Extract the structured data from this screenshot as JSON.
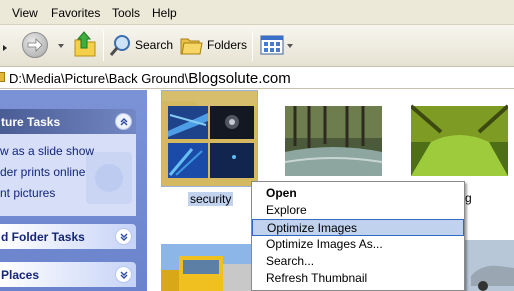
{
  "menubar": {
    "items": [
      {
        "label": "View"
      },
      {
        "label": "Favorites"
      },
      {
        "label": "Tools"
      },
      {
        "label": "Help"
      }
    ]
  },
  "toolbar": {
    "search_label": "Search",
    "folders_label": "Folders"
  },
  "address": {
    "path": "D:\\Media\\Picture\\Back Ground\\",
    "site": "Blogsolute.com"
  },
  "taskpane": {
    "picture_tasks": {
      "title": "ture Tasks",
      "items": [
        {
          "label": "w as a slide show"
        },
        {
          "label": "der prints online"
        },
        {
          "label": "nt pictures"
        }
      ]
    },
    "file_folder_tasks": {
      "title": "d Folder Tasks"
    },
    "other_places": {
      "title": "Places"
    }
  },
  "files": [
    {
      "label": "security"
    },
    {
      "label": "g"
    }
  ],
  "context_menu": {
    "items": [
      {
        "label": "Open"
      },
      {
        "label": "Explore"
      },
      {
        "label": "Optimize Images"
      },
      {
        "label": "Optimize Images As..."
      },
      {
        "label": "Search..."
      },
      {
        "label": "Refresh Thumbnail"
      }
    ]
  },
  "colors": {
    "taskpane_blue": "#6a83cc",
    "selection_blue": "#316ac5",
    "menu_highlight": "#c1d2ee"
  }
}
